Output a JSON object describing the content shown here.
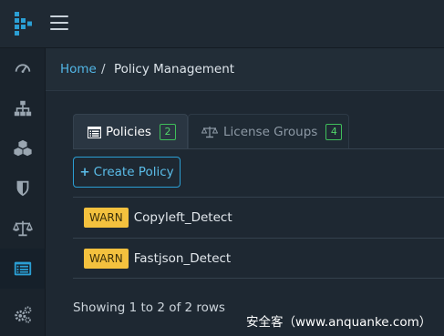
{
  "header": {
    "menu_icon": "hamburger-icon",
    "logo_color": "#2b9fd4"
  },
  "sidebar": {
    "items": [
      {
        "icon": "dashboard-icon",
        "active": false
      },
      {
        "icon": "sitemap-icon",
        "active": false
      },
      {
        "icon": "cubes-icon",
        "active": false
      },
      {
        "icon": "shield-icon",
        "active": false
      },
      {
        "icon": "balance-scale-icon",
        "active": false
      },
      {
        "icon": "list-alt-icon",
        "active": true
      },
      {
        "icon": "cogs-icon",
        "active": false
      }
    ]
  },
  "breadcrumb": {
    "home": "Home",
    "separator": "/",
    "current": "Policy Management"
  },
  "tabs": [
    {
      "label": "Policies",
      "count": "2",
      "icon": "list-alt-icon",
      "active": true
    },
    {
      "label": "License Groups",
      "count": "4",
      "icon": "balance-scale-icon",
      "active": false
    }
  ],
  "create_button": {
    "label": "Create Policy",
    "icon": "plus-icon"
  },
  "policies": [
    {
      "severity": "WARN",
      "name": "Copyleft_Detect"
    },
    {
      "severity": "WARN",
      "name": "Fastjson_Detect"
    }
  ],
  "footer": {
    "showing": "Showing 1 to 2 of 2 rows"
  },
  "watermark": "安全客（www.anquanke.com）",
  "colors": {
    "accent": "#2b9fd4",
    "warn": "#f3c13e",
    "badge": "#3fbf5a",
    "background": "#1e2832"
  }
}
